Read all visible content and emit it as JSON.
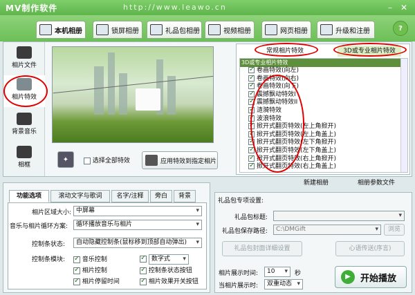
{
  "window": {
    "title": "MV制作软件",
    "url": "http://www.leawo.cn"
  },
  "tabs": [
    {
      "label": "本机相册",
      "active": true
    },
    {
      "label": "锁屏相册"
    },
    {
      "label": "礼品包相册"
    },
    {
      "label": "视频相册"
    },
    {
      "label": "网页相册"
    },
    {
      "label": "升级和注册"
    }
  ],
  "help_label": "?",
  "sidebar": [
    {
      "label": "相片文件",
      "icon": "camera-icon"
    },
    {
      "label": "相片特效",
      "icon": "sparkle-icon",
      "active": true
    },
    {
      "label": "背景音乐",
      "icon": "music-note-icon"
    },
    {
      "label": "相框",
      "icon": "frame-icon"
    }
  ],
  "preview": {
    "select_all_label": "选择全部特效",
    "apply_label": "应用特效到指定相片"
  },
  "effects": {
    "tab_normal": "常规相片特效",
    "tab_3d": "3D或专业相片特效",
    "list_header": "3D或专业相片特效",
    "items": [
      "卷画特效(向左)",
      "卷画特效(向右)",
      "卷画特效(向下)",
      "震撼飘动特效I",
      "震撼飘动特效II",
      "涟漪特效",
      "波浪特效",
      "掀开式翻页特效(左上角掀开)",
      "掀开式翻页特效(左上角盖上)",
      "掀开式翻页特效(左下角掀开)",
      "掀开式翻页特效(左下角盖上)",
      "掀开式翻页特效(右上角掀开)",
      "掀开式翻页特效(右上角盖上)"
    ]
  },
  "actions": {
    "new_album": "新建相册",
    "album_params": "相册参数文件"
  },
  "lower_tabs": [
    "功能选项",
    "滚动文字与歌词",
    "名字/注释",
    "旁白",
    "背景"
  ],
  "options": {
    "area_size_label": "相片区域大小:",
    "area_size_value": "中屏幕",
    "loop_label": "音乐与相片循环方案:",
    "loop_value": "循环播放音乐与相片",
    "control_status_label": "控制条状态:",
    "control_status_value": "自动隐藏控制条(鼠标移到顶部自动弹出)",
    "control_modules_label": "控制条模块:",
    "modules": [
      {
        "label": "音乐控制",
        "checked": true
      },
      {
        "label": "数字式",
        "checked": true
      },
      {
        "label": "相片控制",
        "checked": true
      },
      {
        "label": "控制条状态按钮",
        "checked": true
      },
      {
        "label": "相片停留时间",
        "checked": true
      },
      {
        "label": "相片效果开关按钮",
        "checked": true
      }
    ]
  },
  "gift": {
    "section_title": "礼品包专项设置:",
    "title_label": "礼品包标题:",
    "title_value": "",
    "path_label": "礼品包保存路径:",
    "path_value": "C:\\DMGift",
    "browse_label": "浏览",
    "open_settings_label": "礼品包封面详细设置",
    "send_label": "心语传送(序言)"
  },
  "display": {
    "time_label": "相片展示时间:",
    "time_value": "10",
    "time_unit": "秒",
    "mode_label": "当相片展示时:",
    "mode_value": "双重动态"
  },
  "play_label": "开始播放"
}
